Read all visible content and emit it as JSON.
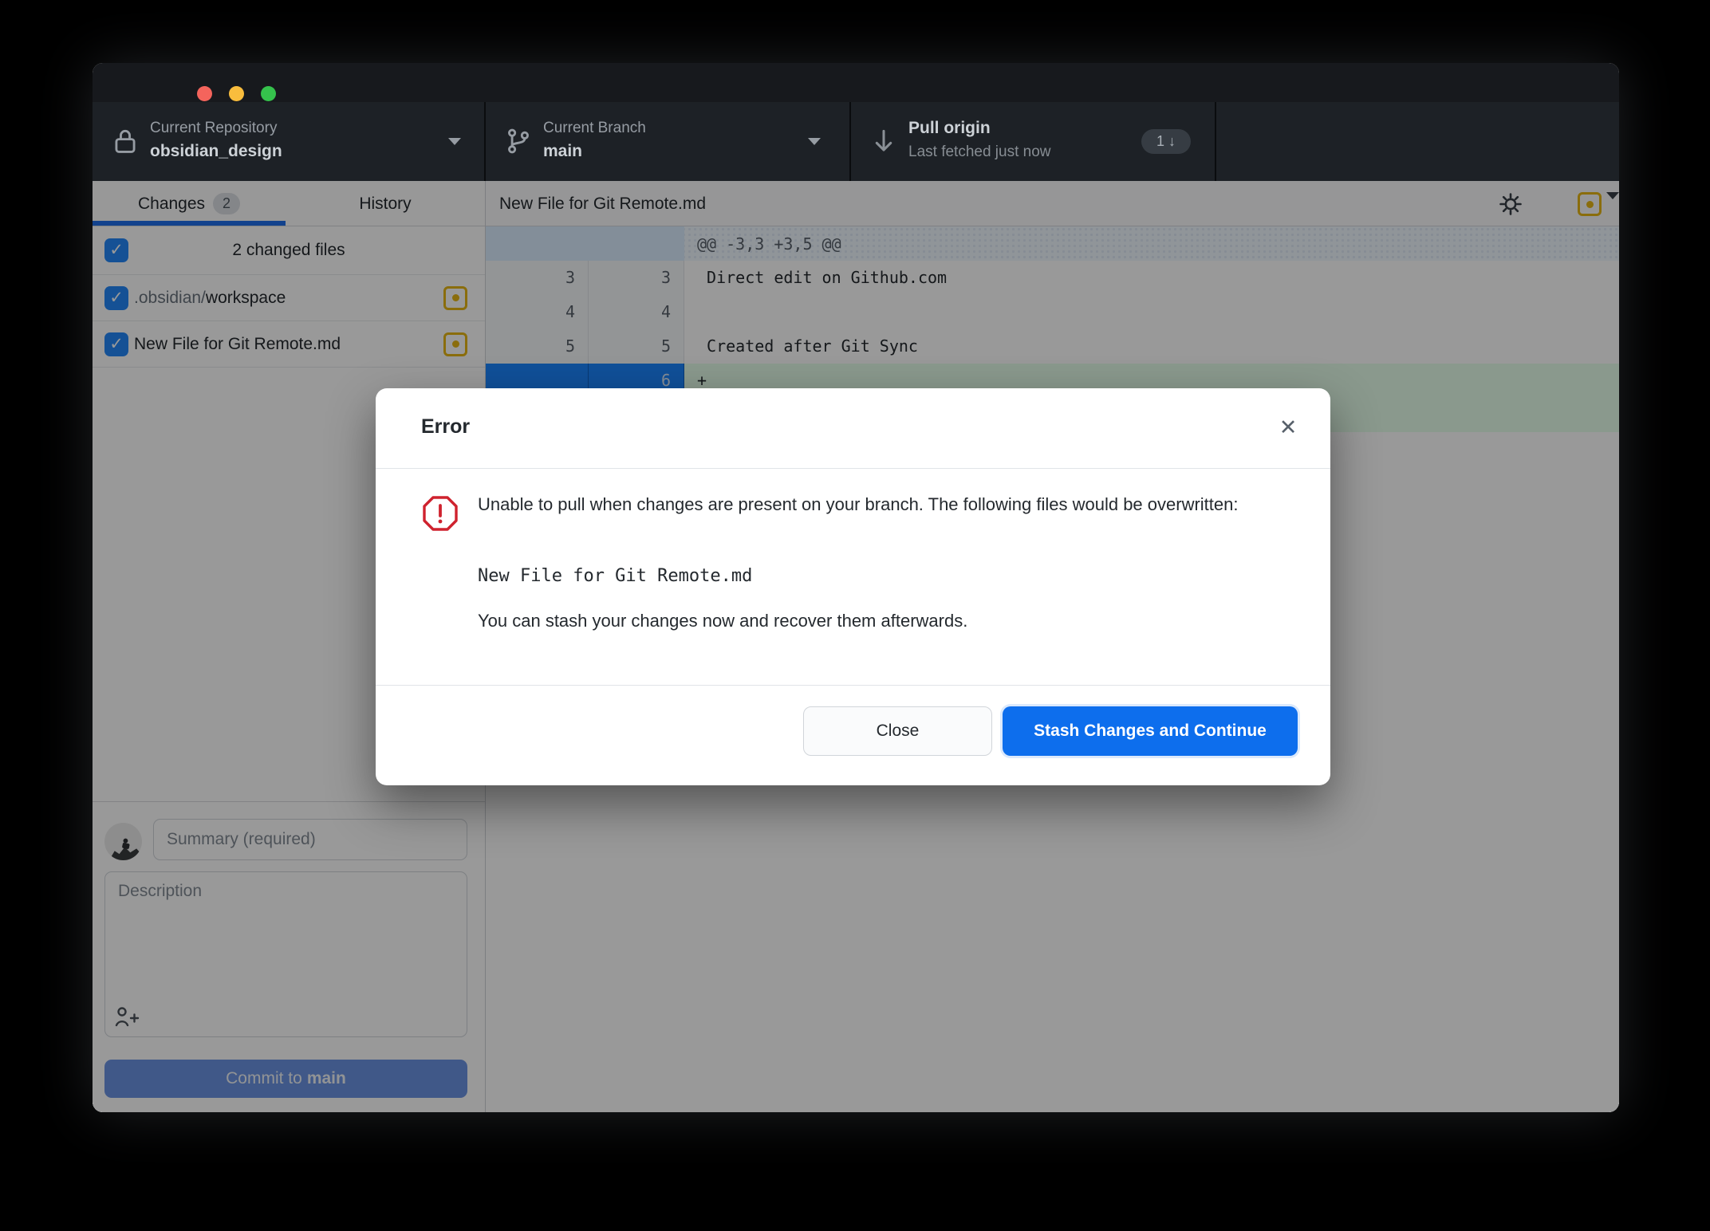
{
  "toolbar": {
    "repository": {
      "label": "Current Repository",
      "value": "obsidian_design",
      "icon": "lock-icon"
    },
    "branch": {
      "label": "Current Branch",
      "value": "main",
      "icon": "git-branch-icon"
    },
    "pull": {
      "title": "Pull origin",
      "subtitle": "Last fetched just now",
      "badge_count": "1",
      "badge_arrow": "↓",
      "icon": "arrow-down-icon"
    }
  },
  "tabs": {
    "changes_label": "Changes",
    "changes_badge": "2",
    "history_label": "History"
  },
  "file_list": {
    "header": "2 changed files",
    "files": [
      {
        "dir": ".obsidian/",
        "name": "workspace",
        "status": "modified"
      },
      {
        "dir": "",
        "name": "New File for Git Remote.md",
        "status": "modified"
      }
    ]
  },
  "diff": {
    "file_title": "New File for Git Remote.md",
    "hunk_header": "@@ -3,3 +3,5 @@",
    "lines": [
      {
        "old": "3",
        "new": "3",
        "text": " Direct edit on Github.com",
        "type": "context"
      },
      {
        "old": "4",
        "new": "4",
        "text": "",
        "type": "context"
      },
      {
        "old": "5",
        "new": "5",
        "text": " Created after Git Sync",
        "type": "context"
      },
      {
        "old": "",
        "new": "6",
        "text": "+",
        "type": "added-selected"
      }
    ]
  },
  "commit": {
    "summary_placeholder": "Summary (required)",
    "description_placeholder": "Description",
    "button_prefix": "Commit to",
    "button_branch": "main"
  },
  "dialog": {
    "title": "Error",
    "close_glyph": "✕",
    "message_line1": "Unable to pull when changes are present on your branch. The following files would be overwritten:",
    "file": "New File for Git Remote.md",
    "message_line2": "You can stash your changes now and recover them afterwards.",
    "buttons": {
      "close": "Close",
      "primary": "Stash Changes and Continue"
    }
  },
  "colors": {
    "accent_blue": "#0d6eed",
    "tab_underline_blue": "#1f6feb",
    "selected_gutter_blue": "#1b86ff",
    "added_green_bg": "#e6ffec",
    "modified_gold": "#e6b614",
    "error_red": "#cf222e",
    "commit_button_blue": "#6b93e3",
    "toolbar_bg": "#1d2126",
    "titlebar_bg": "#17191d"
  }
}
